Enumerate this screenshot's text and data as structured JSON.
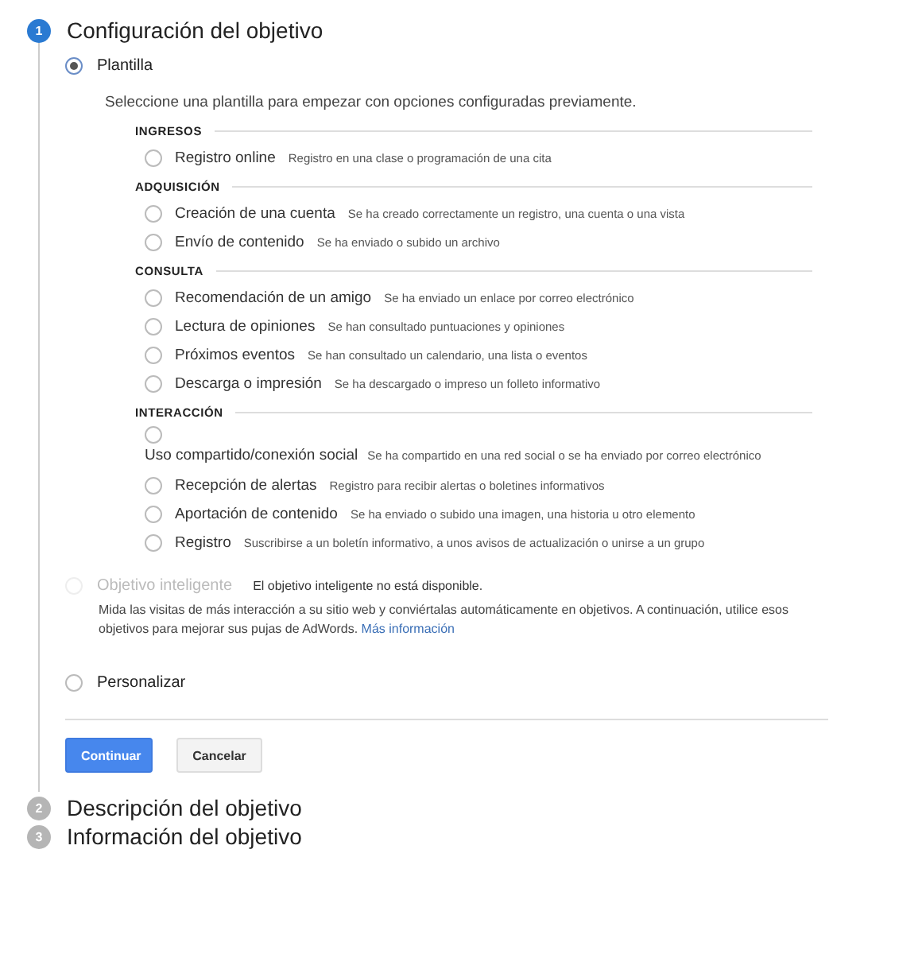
{
  "steps": [
    {
      "number": "1",
      "title": "Configuración del objetivo",
      "active": true
    },
    {
      "number": "2",
      "title": "Descripción del objetivo",
      "active": false
    },
    {
      "number": "3",
      "title": "Información del objetivo",
      "active": false
    }
  ],
  "options": [
    {
      "kind": "template",
      "label": "Plantilla",
      "selected": true,
      "description": "Seleccione una plantilla para empezar con opciones configuradas previamente.",
      "groups": [
        {
          "heading": "INGRESOS",
          "items": [
            {
              "kind": "inline",
              "label": "Registro online",
              "description": "Registro en una clase o programación de una cita",
              "selected": false
            }
          ]
        },
        {
          "heading": "ADQUISICIÓN",
          "items": [
            {
              "kind": "inline",
              "label": "Creación de una cuenta",
              "description": "Se ha creado correctamente un registro, una cuenta o una vista",
              "selected": false
            },
            {
              "kind": "inline",
              "label": "Envío de contenido",
              "description": "Se ha enviado o subido un archivo",
              "selected": false
            }
          ]
        },
        {
          "heading": "CONSULTA",
          "items": [
            {
              "kind": "inline",
              "label": "Recomendación de un amigo",
              "description": "Se ha enviado un enlace por correo electrónico",
              "selected": false
            },
            {
              "kind": "inline",
              "label": "Lectura de opiniones",
              "description": "Se han consultado puntuaciones y opiniones",
              "selected": false
            },
            {
              "kind": "inline",
              "label": "Próximos eventos",
              "description": "Se han consultado un calendario, una lista o eventos",
              "selected": false
            },
            {
              "kind": "inline",
              "label": "Descarga o impresión",
              "description": "Se ha descargado o impreso un folleto informativo",
              "selected": false
            }
          ]
        },
        {
          "heading": "INTERACCIÓN",
          "items": [
            {
              "kind": "stacked",
              "label": "Uso compartido/conexión social",
              "description": "Se ha compartido en una red social o se ha enviado por correo electrónico",
              "selected": false
            },
            {
              "kind": "inline",
              "label": "Recepción de alertas",
              "description": "Registro para recibir alertas o boletines informativos",
              "selected": false
            },
            {
              "kind": "inline",
              "label": "Aportación de contenido",
              "description": "Se ha enviado o subido una imagen, una historia u otro elemento",
              "selected": false
            },
            {
              "kind": "inline",
              "label": "Registro",
              "description": "Suscribirse a un boletín informativo, a unos avisos de actualización o unirse a un grupo",
              "selected": false
            }
          ]
        }
      ]
    },
    {
      "kind": "smart",
      "label": "Objetivo inteligente",
      "selected": false,
      "disabled": true,
      "note": "El objetivo inteligente no está disponible.",
      "description": "Mida las visitas de más interacción a su sitio web y conviértalas automáticamente en objetivos. A continuación, utilice esos objetivos para mejorar sus pujas de AdWords.",
      "link": "Más información"
    },
    {
      "kind": "custom",
      "label": "Personalizar",
      "selected": false
    }
  ],
  "buttons": [
    {
      "label": "Continuar",
      "kind": "primary"
    },
    {
      "label": "Cancelar",
      "kind": "secondary"
    }
  ]
}
